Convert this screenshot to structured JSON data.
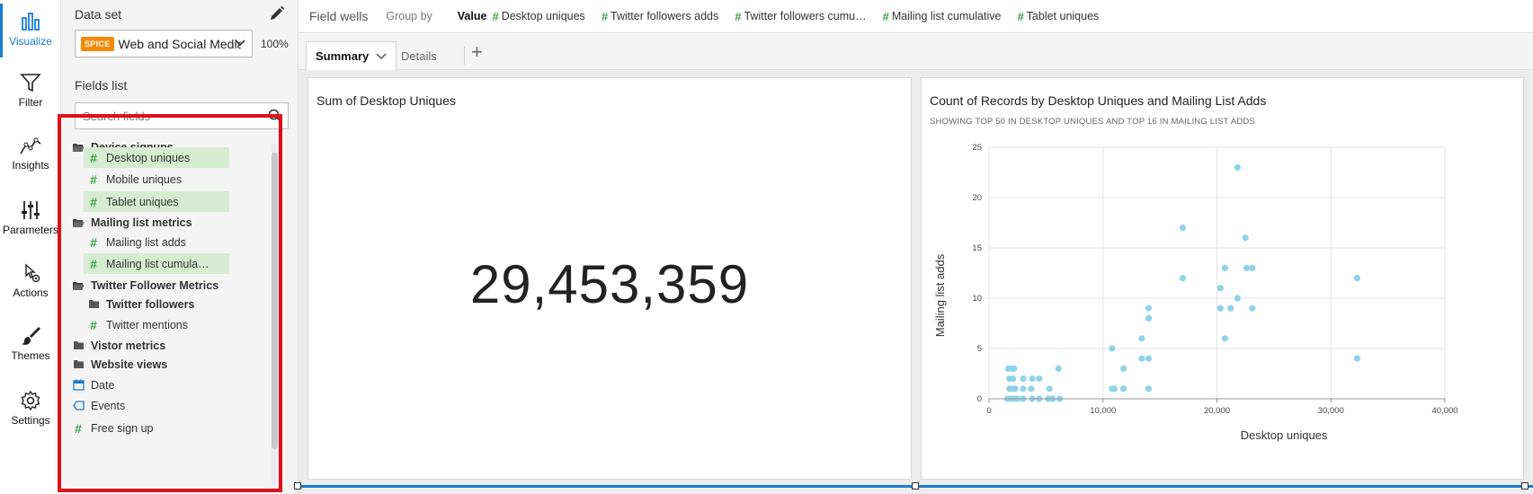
{
  "rail": {
    "items": [
      {
        "label": "Visualize",
        "icon": "bar-chart-icon",
        "active": true
      },
      {
        "label": "Filter",
        "icon": "funnel-icon"
      },
      {
        "label": "Insights",
        "icon": "trend-line-icon"
      },
      {
        "label": "Parameters",
        "icon": "sliders-icon"
      },
      {
        "label": "Actions",
        "icon": "pointer-gear-icon"
      },
      {
        "label": "Themes",
        "icon": "brush-icon"
      },
      {
        "label": "Settings",
        "icon": "gear-icon"
      }
    ]
  },
  "panel": {
    "title": "Data set",
    "dataset_badge": "SPICE",
    "dataset_name": "Web and Social Media Analytics",
    "dataset_pct": "100%",
    "fields_label": "Fields list",
    "search_placeholder": "Search fields",
    "fields": [
      {
        "label": "Device signups",
        "kind": "folder-open"
      },
      {
        "label": "Desktop uniques",
        "kind": "measure",
        "selected": true,
        "indent": true
      },
      {
        "label": "Mobile uniques",
        "kind": "measure",
        "indent": true
      },
      {
        "label": "Tablet uniques",
        "kind": "measure",
        "selected": true,
        "indent": true
      },
      {
        "label": "Mailing list metrics",
        "kind": "folder-open"
      },
      {
        "label": "Mailing list adds",
        "kind": "measure",
        "indent": true
      },
      {
        "label": "Mailing list cumula…",
        "kind": "measure",
        "selected": true,
        "indent": true
      },
      {
        "label": "Twitter Follower Metrics",
        "kind": "folder-open"
      },
      {
        "label": "Twitter followers",
        "kind": "folder",
        "indent": true
      },
      {
        "label": "Twitter mentions",
        "kind": "measure",
        "indent": true
      },
      {
        "label": "Vistor metrics",
        "kind": "folder"
      },
      {
        "label": "Website views",
        "kind": "folder"
      },
      {
        "label": "Date",
        "kind": "date"
      },
      {
        "label": "Events",
        "kind": "dimension"
      },
      {
        "label": "Free sign up",
        "kind": "measure"
      }
    ]
  },
  "wells": {
    "title": "Field wells",
    "group_by": "Group by",
    "value_label": "Value",
    "pills": [
      "Desktop uniques",
      "Twitter followers adds",
      "Twitter followers cumu…",
      "Mailing list cumulative",
      "Tablet uniques"
    ]
  },
  "tabs": {
    "summary": "Summary",
    "details": "Details",
    "add": "+"
  },
  "kpi_card": {
    "title": "Sum of Desktop Uniques",
    "value": "29,453,359"
  },
  "scatter_card": {
    "title": "Count of Records by Desktop Uniques and Mailing List Adds",
    "subtitle": "SHOWING TOP 50 IN DESKTOP UNIQUES AND TOP 16 IN MAILING LIST ADDS"
  },
  "colors": {
    "accent": "#1a7dcf",
    "measure_green": "#3aa547",
    "spice_orange": "#f58a07",
    "selected_field": "#d5ecd0",
    "point": "#8fd3ea",
    "highlight": "#e0101a"
  },
  "chart_data": {
    "type": "scatter",
    "title": "Count of Records by Desktop Uniques and Mailing List Adds",
    "subtitle": "SHOWING TOP 50 IN DESKTOP UNIQUES AND TOP 16 IN MAILING LIST ADDS",
    "xlabel": "Desktop uniques",
    "ylabel": "Mailing list adds",
    "xlim": [
      0,
      40000
    ],
    "ylim": [
      0,
      25
    ],
    "xticks": [
      0,
      10000,
      20000,
      30000,
      40000
    ],
    "xtick_labels": [
      "0",
      "10,000",
      "20,000",
      "30,000",
      "40,000"
    ],
    "yticks": [
      0,
      5,
      10,
      15,
      20,
      25
    ],
    "ytick_labels": [
      "0",
      "5",
      "10",
      "15",
      "20",
      "25"
    ],
    "grid": true,
    "points": [
      [
        1700,
        3
      ],
      [
        2000,
        3
      ],
      [
        2200,
        3
      ],
      [
        1800,
        2
      ],
      [
        2100,
        2
      ],
      [
        1800,
        1
      ],
      [
        2100,
        1
      ],
      [
        2300,
        1
      ],
      [
        1600,
        0
      ],
      [
        1900,
        0
      ],
      [
        2200,
        0
      ],
      [
        2500,
        0
      ],
      [
        3000,
        2
      ],
      [
        3000,
        1
      ],
      [
        3000,
        0
      ],
      [
        3800,
        2
      ],
      [
        3700,
        1
      ],
      [
        3800,
        0
      ],
      [
        4400,
        2
      ],
      [
        4400,
        0
      ],
      [
        5300,
        1
      ],
      [
        5200,
        0
      ],
      [
        5600,
        0
      ],
      [
        6100,
        3
      ],
      [
        6200,
        0
      ],
      [
        10800,
        5
      ],
      [
        10800,
        1
      ],
      [
        11000,
        1
      ],
      [
        11800,
        3
      ],
      [
        11800,
        1
      ],
      [
        13400,
        6
      ],
      [
        13400,
        4
      ],
      [
        14000,
        9
      ],
      [
        14000,
        8
      ],
      [
        14000,
        4
      ],
      [
        14000,
        1
      ],
      [
        17000,
        17
      ],
      [
        17000,
        12
      ],
      [
        20300,
        11
      ],
      [
        20300,
        9
      ],
      [
        20700,
        13
      ],
      [
        20700,
        6
      ],
      [
        21200,
        9
      ],
      [
        21800,
        23
      ],
      [
        21800,
        10
      ],
      [
        22500,
        16
      ],
      [
        22600,
        13
      ],
      [
        23100,
        13
      ],
      [
        23100,
        9
      ],
      [
        32300,
        12
      ],
      [
        32300,
        4
      ]
    ]
  }
}
